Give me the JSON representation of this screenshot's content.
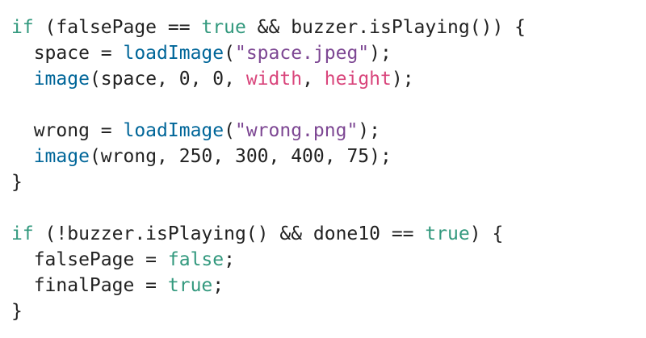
{
  "code": {
    "colors": {
      "keyword": "#33997e",
      "function": "#006699",
      "string": "#7d4793",
      "builtin_var": "#d9467c",
      "plain": "#222222",
      "background": "#ffffff"
    },
    "lines": [
      [
        {
          "t": "if",
          "c": "kw"
        },
        {
          "t": " (falsePage == ",
          "c": "plain"
        },
        {
          "t": "true",
          "c": "kw"
        },
        {
          "t": " && buzzer.isPlaying()) {",
          "c": "plain"
        }
      ],
      [
        {
          "t": "  space = ",
          "c": "plain"
        },
        {
          "t": "loadImage",
          "c": "fn"
        },
        {
          "t": "(",
          "c": "plain"
        },
        {
          "t": "\"space.jpeg\"",
          "c": "str"
        },
        {
          "t": ");",
          "c": "plain"
        }
      ],
      [
        {
          "t": "  ",
          "c": "plain"
        },
        {
          "t": "image",
          "c": "fn"
        },
        {
          "t": "(space, 0, 0, ",
          "c": "plain"
        },
        {
          "t": "width",
          "c": "var"
        },
        {
          "t": ", ",
          "c": "plain"
        },
        {
          "t": "height",
          "c": "var"
        },
        {
          "t": ");",
          "c": "plain"
        }
      ],
      [],
      [
        {
          "t": "  wrong = ",
          "c": "plain"
        },
        {
          "t": "loadImage",
          "c": "fn"
        },
        {
          "t": "(",
          "c": "plain"
        },
        {
          "t": "\"wrong.png\"",
          "c": "str"
        },
        {
          "t": ");",
          "c": "plain"
        }
      ],
      [
        {
          "t": "  ",
          "c": "plain"
        },
        {
          "t": "image",
          "c": "fn"
        },
        {
          "t": "(wrong, 250, 300, 400, 75);",
          "c": "plain"
        }
      ],
      [
        {
          "t": "}",
          "c": "plain"
        }
      ],
      [],
      [
        {
          "t": "if",
          "c": "kw"
        },
        {
          "t": " (!buzzer.isPlaying() && done10 == ",
          "c": "plain"
        },
        {
          "t": "true",
          "c": "kw"
        },
        {
          "t": ") {",
          "c": "plain"
        }
      ],
      [
        {
          "t": "  falsePage = ",
          "c": "plain"
        },
        {
          "t": "false",
          "c": "kw"
        },
        {
          "t": ";",
          "c": "plain"
        }
      ],
      [
        {
          "t": "  finalPage = ",
          "c": "plain"
        },
        {
          "t": "true",
          "c": "kw"
        },
        {
          "t": ";",
          "c": "plain"
        }
      ],
      [
        {
          "t": "}",
          "c": "plain"
        }
      ]
    ]
  }
}
